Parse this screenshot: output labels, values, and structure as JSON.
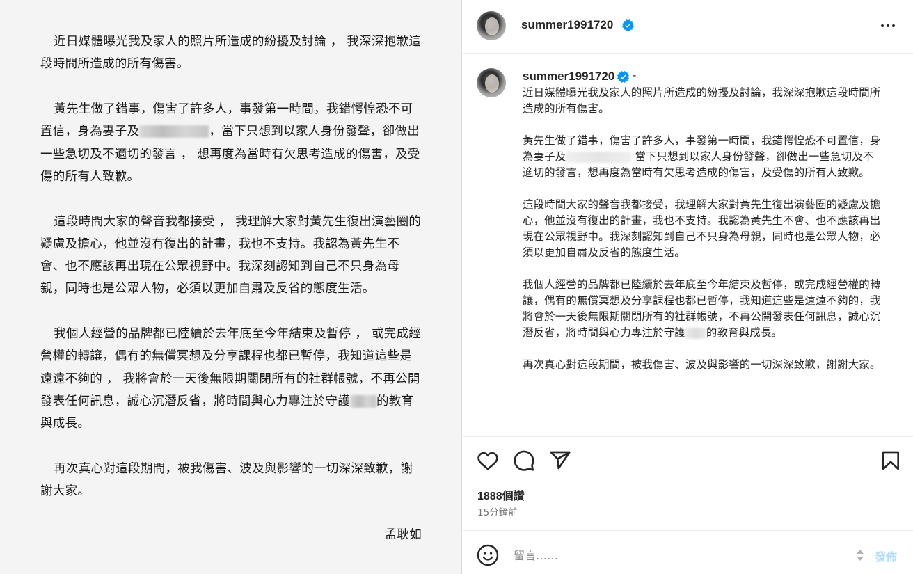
{
  "letter": {
    "paragraphs": [
      "近日媒體曝光我及家人的照片所造成的紛擾及討論 ， 我深深抱歉這段時間所造成的所有傷害。",
      [
        "黃先生做了錯事，傷害了許多人，事發第一時間，我錯愕惶恐不可置信，身為妻子及",
        "，當下只想到以家人身份發聲，卻做出一些急切及不適切的發言 ， 想再度為當時有欠思考造成的傷害，及受傷的所有人致歉。"
      ],
      "這段時間大家的聲音我都接受 ， 我理解大家對黃先生復出演藝圈的疑慮及擔心，他並沒有復出的計畫，我也不支持。我認為黃先生不會、也不應該再出現在公眾視野中。我深刻認知到自己不只身為母親，同時也是公眾人物，必須以更加自肅及反省的態度生活。",
      [
        "我個人經營的品牌都已陸續於去年底至今年結束及暫停 ， 或完成經營權的轉讓，偶有的無償冥想及分享課程也都已暫停，我知道這些是遠遠不夠的 ， 我將會於一天後無限期關閉所有的社群帳號，不再公開發表任何訊息，誠心沉潛反省，將時間與心力專注於守護",
        "的教育與成長。"
      ],
      "再次真心對這段期間，被我傷害、波及與影響的一切深深致歉，謝謝大家。"
    ],
    "signature": "孟耿如"
  },
  "header": {
    "username": "summer1991720",
    "verified": true
  },
  "caption": {
    "username": "summer1991720",
    "separator": "-",
    "p1": "近日媒體曝光我及家人的照片所造成的紛擾及討論，我深深抱歉這段時間所造成的所有傷害。",
    "p2a": "黃先生做了錯事，傷害了許多人，事發第一時間，我錯愕惶恐不可置信，身為妻子及",
    "p2b": "當下只想到以家人身份發聲，卻做出一些急切及不適切的發言，想再度為當時有欠思考造成的傷害，及受傷的所有人致歉。",
    "p3": "這段時間大家的聲音我都接受，我理解大家對黃先生復出演藝圈的疑慮及擔心，他並沒有復出的計畫，我也不支持。我認為黃先生不會、也不應該再出現在公眾視野中。我深刻認知到自己不只身為母親，同時也是公眾人物，必須以更加自肅及反省的態度生活。",
    "p4a": "我個人經營的品牌都已陸續於去年底至今年結束及暫停，或完成經營權的轉讓，偶有的無償冥想及分享課程也都已暫停，我知道這些是遠遠不夠的，我將會於一天後無限期關閉所有的社群帳號，不再公開發表任何訊息，誠心沉潛反省，將時間與心力專注於守護",
    "p4b": "的教育與成長。",
    "p5": "再次真心對這段期間，被我傷害、波及與影響的一切深深致歉，謝謝大家。"
  },
  "stats": {
    "likes": "1888個讚",
    "time_ago": "15分鐘前"
  },
  "comment": {
    "placeholder": "留言……",
    "post_label": "發佈"
  },
  "icons": {
    "more": "more-horizontal-icon",
    "like": "heart-icon",
    "comment": "comment-bubble-icon",
    "share": "paper-plane-icon",
    "save": "bookmark-icon",
    "emoji": "smiley-icon",
    "verified": "verified-badge-icon"
  },
  "colors": {
    "verified_blue": "#0095f6",
    "post_button_disabled": "#b3dbff",
    "secondary_text": "#737373"
  }
}
